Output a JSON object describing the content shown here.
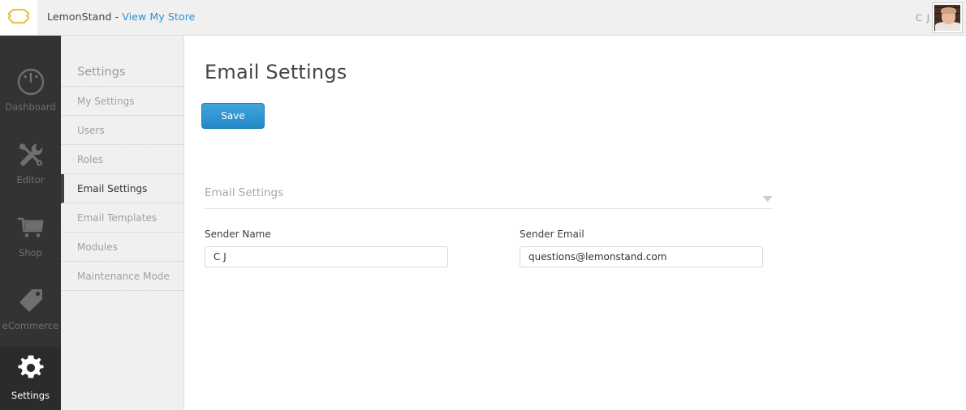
{
  "header": {
    "logo_icon": "lemon-brace-icon",
    "brand_name": "LemonStand",
    "separator": " - ",
    "store_link": "View My Store",
    "user_initials": "C J",
    "avatar_alt": "user-avatar-photo",
    "colors": {
      "link": "#2a93d6",
      "logo": "#e8c54a",
      "background": "#f0f0f0"
    }
  },
  "rail": {
    "items": [
      {
        "label": "Dashboard",
        "icon": "gauge-icon",
        "active": false
      },
      {
        "label": "Editor",
        "icon": "tools-icon",
        "active": false
      },
      {
        "label": "Shop",
        "icon": "cart-icon",
        "active": false
      },
      {
        "label": "eCommerce",
        "icon": "tag-icon",
        "active": false
      },
      {
        "label": "Settings",
        "icon": "gear-icon",
        "active": true
      }
    ]
  },
  "submenu": {
    "title": "Settings",
    "items": [
      {
        "label": "My Settings",
        "active": false
      },
      {
        "label": "Users",
        "active": false
      },
      {
        "label": "Roles",
        "active": false
      },
      {
        "label": "Email Settings",
        "active": true
      },
      {
        "label": "Email Templates",
        "active": false
      },
      {
        "label": "Modules",
        "active": false
      },
      {
        "label": "Maintenance Mode",
        "active": false
      }
    ]
  },
  "main": {
    "page_title": "Email Settings",
    "save_label": "Save",
    "section": {
      "label": "Email Settings",
      "toggle_icon": "chevron-down-icon",
      "expanded": true
    },
    "fields": [
      {
        "label": "Sender Name",
        "value": "C J",
        "placeholder": ""
      },
      {
        "label": "Sender Email",
        "value": "questions@lemonstand.com",
        "placeholder": ""
      }
    ]
  }
}
